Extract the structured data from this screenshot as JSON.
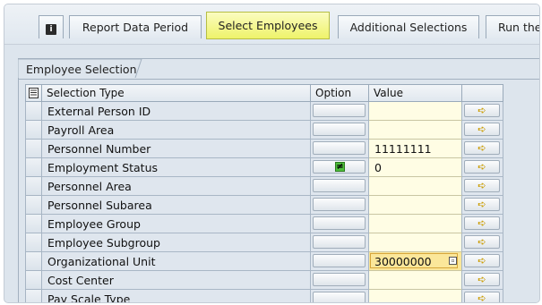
{
  "tabs": [
    {
      "label": "",
      "icon": "info-icon",
      "active": false
    },
    {
      "label": "Report Data Period",
      "active": false
    },
    {
      "label": "Select Employees",
      "active": true
    },
    {
      "label": "Additional Selections",
      "active": false
    },
    {
      "label": "Run the",
      "active": false
    }
  ],
  "colors": {
    "active_tab": "#eef36a",
    "value_field": "#fffde4",
    "focused_field": "#fbe79a",
    "background": "#dde5ed"
  },
  "group": {
    "title": "Employee Selection"
  },
  "table": {
    "headers": {
      "selection_type": "Selection Type",
      "option": "Option",
      "value": "Value"
    },
    "rows": [
      {
        "type": "External Person ID",
        "option": "",
        "value": ""
      },
      {
        "type": "Payroll Area",
        "option": "",
        "value": ""
      },
      {
        "type": "Personnel Number",
        "option": "",
        "value": "11111111"
      },
      {
        "type": "Employment Status",
        "option": "≠",
        "value": "0"
      },
      {
        "type": "Personnel Area",
        "option": "",
        "value": ""
      },
      {
        "type": "Personnel Subarea",
        "option": "",
        "value": ""
      },
      {
        "type": "Employee Group",
        "option": "",
        "value": ""
      },
      {
        "type": "Employee Subgroup",
        "option": "",
        "value": ""
      },
      {
        "type": "Organizational Unit",
        "option": "",
        "value": "30000000",
        "focused": true
      },
      {
        "type": "Cost Center",
        "option": "",
        "value": ""
      },
      {
        "type": "Pay Scale Type",
        "option": "",
        "value": ""
      }
    ]
  }
}
